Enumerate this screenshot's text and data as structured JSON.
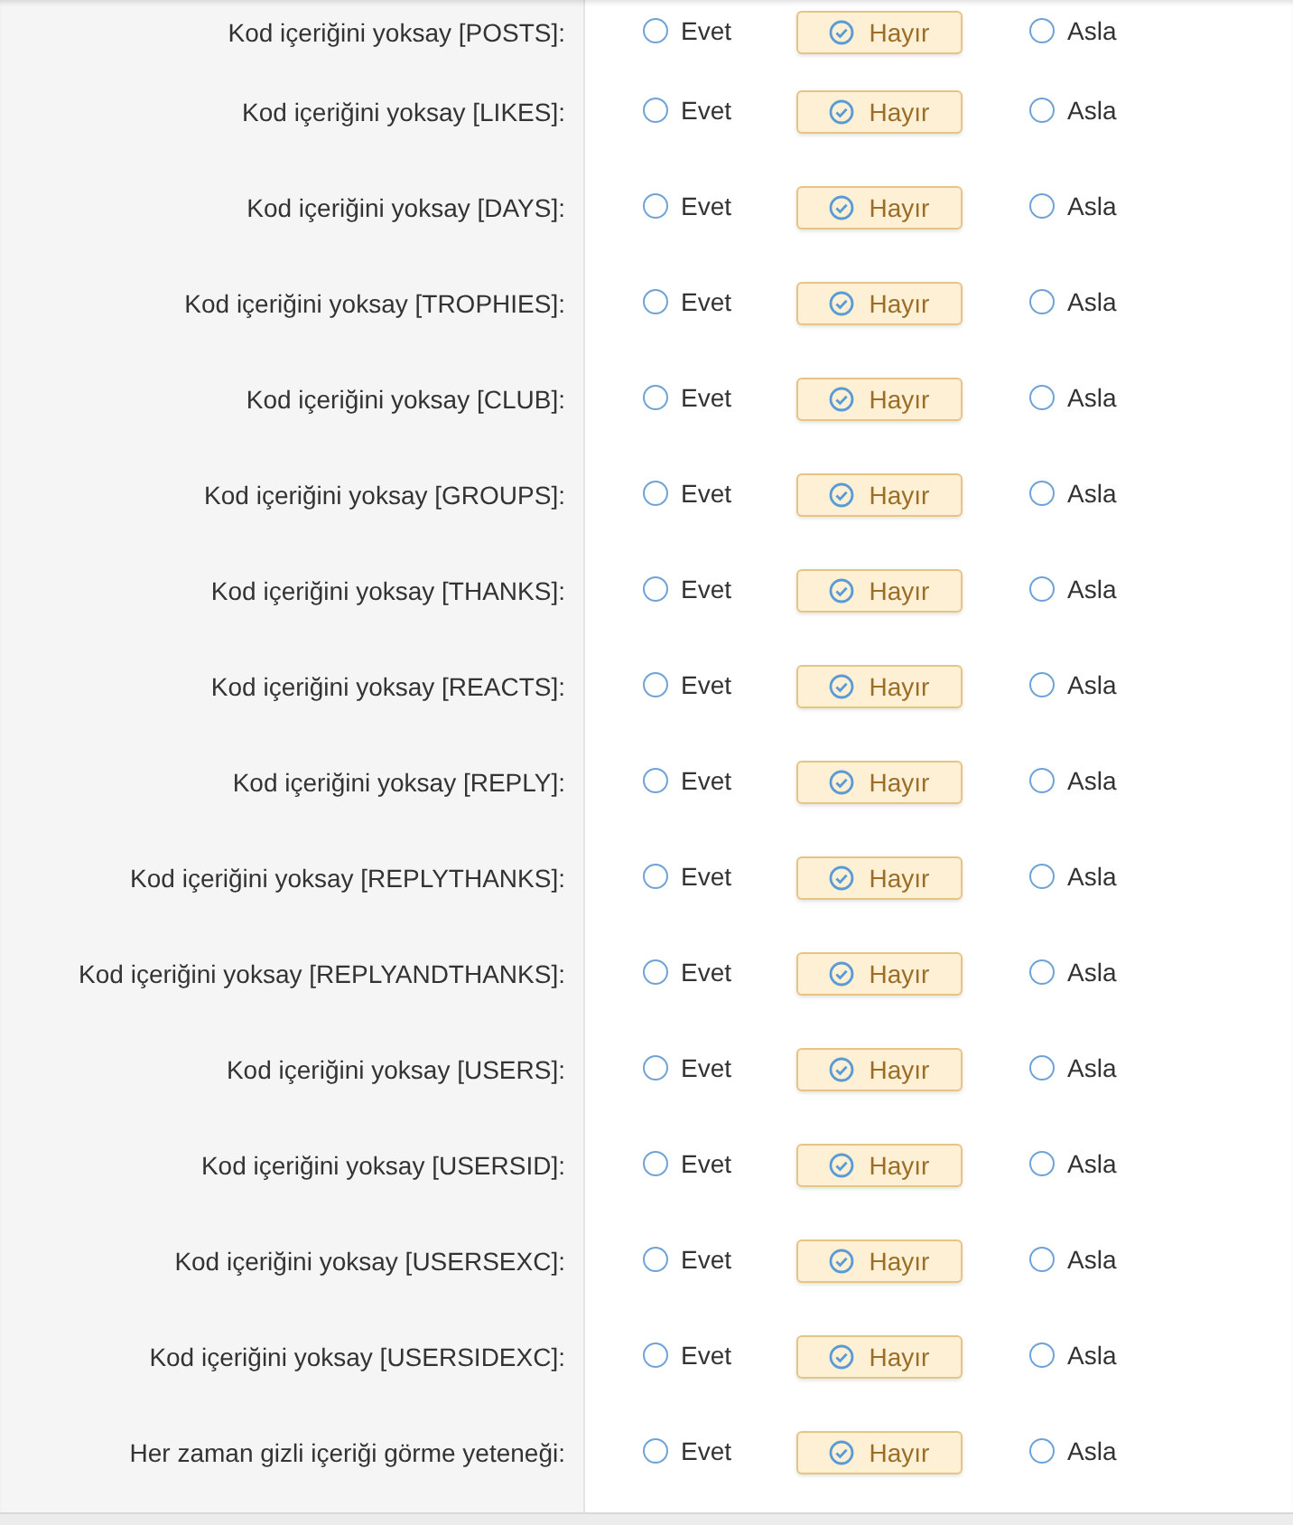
{
  "rows": [
    {
      "label": "Kod içeriğini yoksay [POSTS]:",
      "options": [
        {
          "label": "Evet",
          "selected": false
        },
        {
          "label": "Hayır",
          "selected": true
        },
        {
          "label": "Asla",
          "selected": false
        }
      ]
    },
    {
      "label": "Kod içeriğini yoksay [LIKES]:",
      "options": [
        {
          "label": "Evet",
          "selected": false
        },
        {
          "label": "Hayır",
          "selected": true
        },
        {
          "label": "Asla",
          "selected": false
        }
      ]
    },
    {
      "label": "Kod içeriğini yoksay [DAYS]:",
      "options": [
        {
          "label": "Evet",
          "selected": false
        },
        {
          "label": "Hayır",
          "selected": true
        },
        {
          "label": "Asla",
          "selected": false
        }
      ]
    },
    {
      "label": "Kod içeriğini yoksay [TROPHIES]:",
      "options": [
        {
          "label": "Evet",
          "selected": false
        },
        {
          "label": "Hayır",
          "selected": true
        },
        {
          "label": "Asla",
          "selected": false
        }
      ]
    },
    {
      "label": "Kod içeriğini yoksay [CLUB]:",
      "options": [
        {
          "label": "Evet",
          "selected": false
        },
        {
          "label": "Hayır",
          "selected": true
        },
        {
          "label": "Asla",
          "selected": false
        }
      ]
    },
    {
      "label": "Kod içeriğini yoksay [GROUPS]:",
      "options": [
        {
          "label": "Evet",
          "selected": false
        },
        {
          "label": "Hayır",
          "selected": true
        },
        {
          "label": "Asla",
          "selected": false
        }
      ]
    },
    {
      "label": "Kod içeriğini yoksay [THANKS]:",
      "options": [
        {
          "label": "Evet",
          "selected": false
        },
        {
          "label": "Hayır",
          "selected": true
        },
        {
          "label": "Asla",
          "selected": false
        }
      ]
    },
    {
      "label": "Kod içeriğini yoksay [REACTS]:",
      "options": [
        {
          "label": "Evet",
          "selected": false
        },
        {
          "label": "Hayır",
          "selected": true
        },
        {
          "label": "Asla",
          "selected": false
        }
      ]
    },
    {
      "label": "Kod içeriğini yoksay [REPLY]:",
      "options": [
        {
          "label": "Evet",
          "selected": false
        },
        {
          "label": "Hayır",
          "selected": true
        },
        {
          "label": "Asla",
          "selected": false
        }
      ]
    },
    {
      "label": "Kod içeriğini yoksay [REPLYTHANKS]:",
      "options": [
        {
          "label": "Evet",
          "selected": false
        },
        {
          "label": "Hayır",
          "selected": true
        },
        {
          "label": "Asla",
          "selected": false
        }
      ]
    },
    {
      "label": "Kod içeriğini yoksay [REPLYANDTHANKS]:",
      "options": [
        {
          "label": "Evet",
          "selected": false
        },
        {
          "label": "Hayır",
          "selected": true
        },
        {
          "label": "Asla",
          "selected": false
        }
      ]
    },
    {
      "label": "Kod içeriğini yoksay [USERS]:",
      "options": [
        {
          "label": "Evet",
          "selected": false
        },
        {
          "label": "Hayır",
          "selected": true
        },
        {
          "label": "Asla",
          "selected": false
        }
      ]
    },
    {
      "label": "Kod içeriğini yoksay [USERSID]:",
      "options": [
        {
          "label": "Evet",
          "selected": false
        },
        {
          "label": "Hayır",
          "selected": true
        },
        {
          "label": "Asla",
          "selected": false
        }
      ]
    },
    {
      "label": "Kod içeriğini yoksay [USERSEXC]:",
      "options": [
        {
          "label": "Evet",
          "selected": false
        },
        {
          "label": "Hayır",
          "selected": true
        },
        {
          "label": "Asla",
          "selected": false
        }
      ]
    },
    {
      "label": "Kod içeriğini yoksay [USERSIDEXC]:",
      "options": [
        {
          "label": "Evet",
          "selected": false
        },
        {
          "label": "Hayır",
          "selected": true
        },
        {
          "label": "Asla",
          "selected": false
        }
      ]
    },
    {
      "label": "Her zaman gizli içeriği görme yeteneği:",
      "options": [
        {
          "label": "Evet",
          "selected": false
        },
        {
          "label": "Hayır",
          "selected": true
        },
        {
          "label": "Asla",
          "selected": false
        }
      ]
    }
  ]
}
